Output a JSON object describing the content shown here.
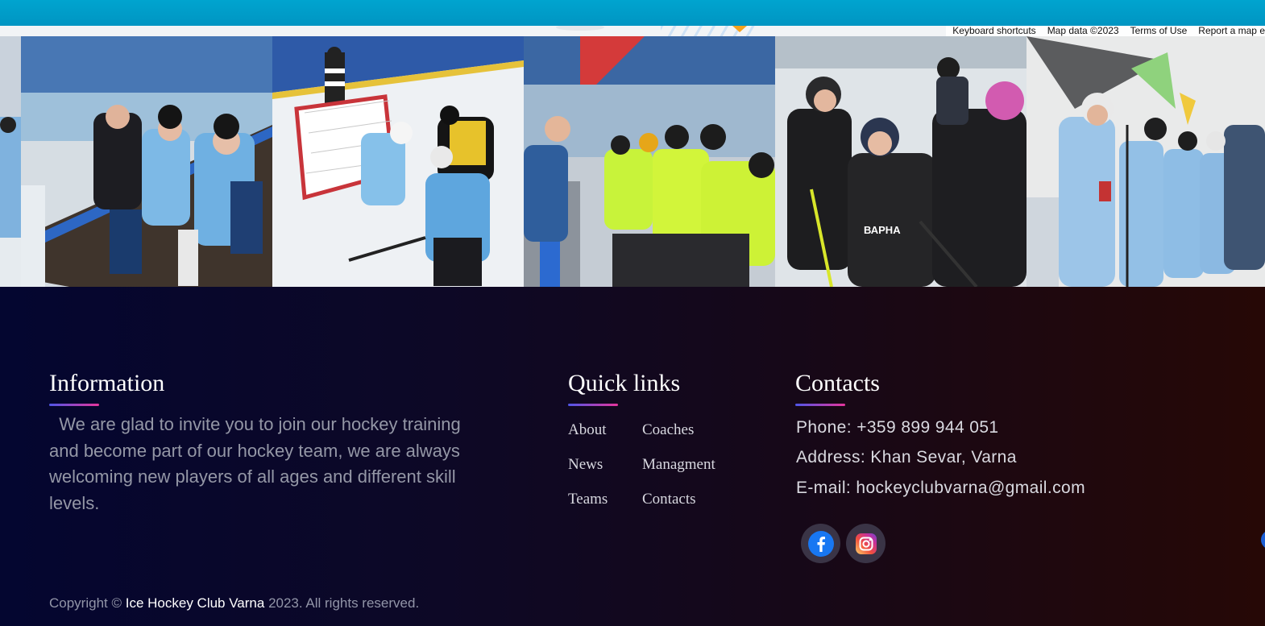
{
  "map": {
    "attribution": [
      "Keyboard shortcuts",
      "Map data ©2023",
      "Terms of Use",
      "Report a map e"
    ]
  },
  "gallery": [
    {
      "name": "team-bench-photo"
    },
    {
      "name": "goal-save-photo"
    },
    {
      "name": "youth-bench-photo"
    },
    {
      "name": "youth-celebration-photo"
    },
    {
      "name": "youth-tunnel-photo"
    }
  ],
  "footer": {
    "information": {
      "title": "Information",
      "text": "  We are glad to invite you to join our hockey training and become part of our hockey team, we are always welcoming new players of all ages and different skill levels."
    },
    "quick_links": {
      "title": "Quick links",
      "items": [
        "About",
        "Coaches",
        "News",
        "Managment",
        "Teams",
        "Contacts"
      ]
    },
    "contacts": {
      "title": "Contacts",
      "phone": "Phone: +359 899 944 051",
      "address": "Address: Khan Sevar, Varna",
      "email": "E-mail: hockeyclubvarna@gmail.com",
      "social": [
        "facebook-icon",
        "instagram-icon"
      ]
    },
    "copyright": {
      "prefix": "Copyright © ",
      "brand": "Ice Hockey Club Varna",
      "suffix": " 2023. All rights reserved."
    }
  },
  "colors": {
    "topbar": "#00a4cf",
    "accent_gradient_start": "#4f56e8",
    "accent_gradient_end": "#e6359c",
    "footer_left": "#040630",
    "footer_right": "#260806"
  }
}
